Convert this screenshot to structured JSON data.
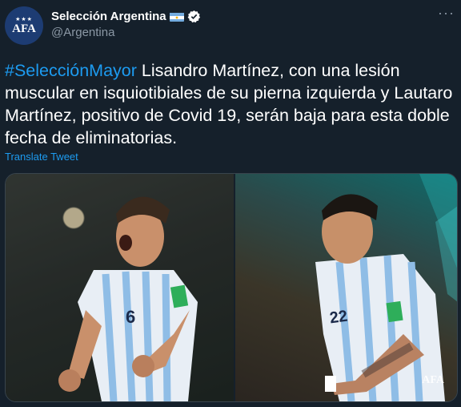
{
  "account": {
    "display_name": "Selección Argentina",
    "handle": "@Argentina",
    "avatar_text": "AFA",
    "avatar_stars": "★★★"
  },
  "more_label": "···",
  "tweet": {
    "hashtag": "#SelecciónMayor",
    "text": " Lisandro Martínez, con una lesión muscular en isquiotibiales de su pierna izquierda y Lautaro Martínez, positivo de Covid 19, serán baja para esta doble fecha de eliminatorias.",
    "translate_label": "Translate Tweet"
  },
  "media": {
    "jersey_left": "6",
    "jersey_right": "22",
    "watermark": "AFA"
  },
  "colors": {
    "background": "#15202b",
    "link": "#1d9bf0",
    "muted": "#8b98a5",
    "verified": "#1d9bf0",
    "flag_blue": "#74acdf"
  },
  "icons": {
    "verified": "verified-badge-icon",
    "flag": "argentina-flag-icon",
    "more": "more-options-icon"
  }
}
